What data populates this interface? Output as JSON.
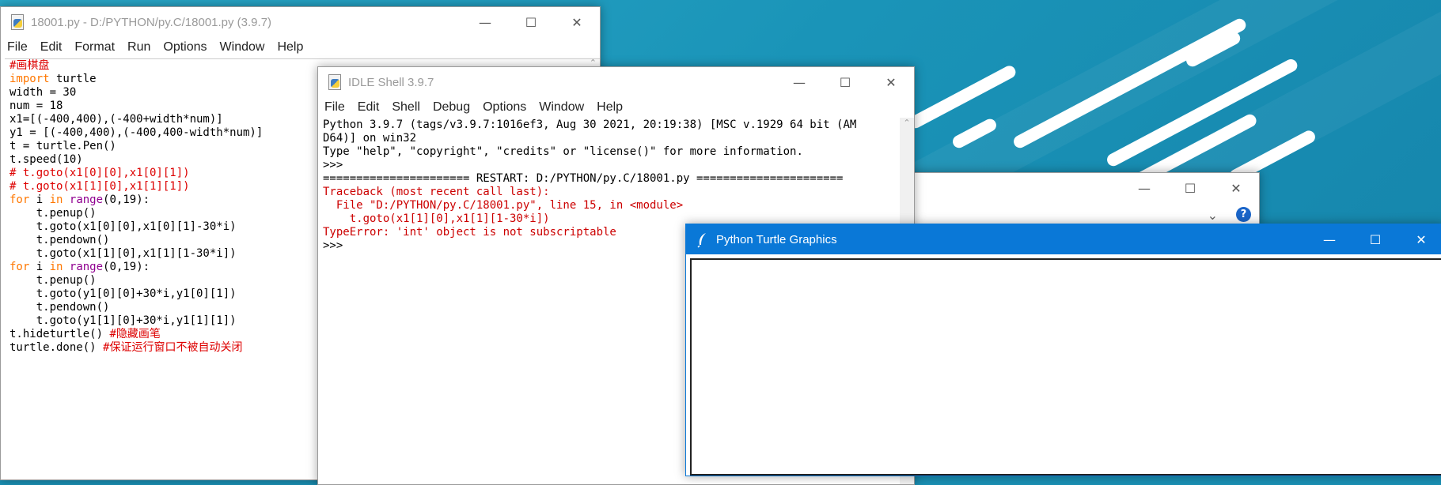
{
  "editor": {
    "title": "18001.py - D:/PYTHON/py.C/18001.py (3.9.7)",
    "menu": [
      "File",
      "Edit",
      "Format",
      "Run",
      "Options",
      "Window",
      "Help"
    ],
    "lines": [
      [
        [
          "cm",
          "#画棋盘"
        ]
      ],
      [
        [
          "kw",
          "import"
        ],
        [
          "",
          " turtle"
        ]
      ],
      [
        [
          "",
          "width = 30"
        ]
      ],
      [
        [
          "",
          "num = 18"
        ]
      ],
      [
        [
          "",
          "x1=[(-400,400),(-400+width*num)]"
        ]
      ],
      [
        [
          "",
          "y1 = [(-400,400),(-400,400-width*num)]"
        ]
      ],
      [
        [
          "",
          "t = turtle.Pen()"
        ]
      ],
      [
        [
          "",
          "t.speed(10)"
        ]
      ],
      [
        [
          "cm",
          "# t.goto(x1[0][0],x1[0][1])"
        ]
      ],
      [
        [
          "cm",
          "# t.goto(x1[1][0],x1[1][1])"
        ]
      ],
      [
        [
          "kw",
          "for"
        ],
        [
          "",
          " i "
        ],
        [
          "kw",
          "in"
        ],
        [
          "",
          " "
        ],
        [
          "bi",
          "range"
        ],
        [
          "",
          "(0,19):"
        ]
      ],
      [
        [
          "",
          "    t.penup()"
        ]
      ],
      [
        [
          "",
          "    t.goto(x1[0][0],x1[0][1]-30*i)"
        ]
      ],
      [
        [
          "",
          "    t.pendown()"
        ]
      ],
      [
        [
          "",
          "    t.goto(x1[1][0],x1[1][1-30*i])"
        ]
      ],
      [
        [
          "kw",
          "for"
        ],
        [
          "",
          " i "
        ],
        [
          "kw",
          "in"
        ],
        [
          "",
          " "
        ],
        [
          "bi",
          "range"
        ],
        [
          "",
          "(0,19):"
        ]
      ],
      [
        [
          "",
          "    t.penup()"
        ]
      ],
      [
        [
          "",
          "    t.goto(y1[0][0]+30*i,y1[0][1])"
        ]
      ],
      [
        [
          "",
          "    t.pendown()"
        ]
      ],
      [
        [
          "",
          "    t.goto(y1[1][0]+30*i,y1[1][1])"
        ]
      ],
      [
        [
          "",
          "t.hideturtle() "
        ],
        [
          "cm",
          "#隐藏画笔"
        ]
      ],
      [
        [
          "",
          "turtle.done() "
        ],
        [
          "cm",
          "#保证运行窗口不被自动关闭"
        ]
      ]
    ]
  },
  "shell": {
    "title": "IDLE Shell 3.9.7",
    "menu": [
      "File",
      "Edit",
      "Shell",
      "Debug",
      "Options",
      "Window",
      "Help"
    ],
    "lines": [
      [
        [
          "shellout",
          "Python 3.9.7 (tags/v3.9.7:1016ef3, Aug 30 2021, 20:19:38) [MSC v.1929 64 bit (AM"
        ]
      ],
      [
        [
          "shellout",
          "D64)] on win32"
        ]
      ],
      [
        [
          "shellout",
          "Type \"help\", \"copyright\", \"credits\" or \"license()\" for more information."
        ]
      ],
      [
        [
          "shellout",
          ">>> "
        ]
      ],
      [
        [
          "shellout",
          "====================== RESTART: D:/PYTHON/py.C/18001.py ======================"
        ]
      ],
      [
        [
          "err",
          "Traceback (most recent call last):"
        ]
      ],
      [
        [
          "err",
          "  File \"D:/PYTHON/py.C/18001.py\", line 15, in <module>"
        ]
      ],
      [
        [
          "err",
          "    t.goto(x1[1][0],x1[1][1-30*i])"
        ]
      ],
      [
        [
          "err",
          "TypeError: 'int' object is not subscriptable"
        ]
      ],
      [
        [
          "shellout",
          ">>> "
        ]
      ]
    ]
  },
  "turtle": {
    "title": "Python Turtle Graphics"
  },
  "caption": {
    "minimize": "—",
    "maximize": "☐",
    "close": "✕"
  },
  "behind_window": {
    "help": "?",
    "chevron": "⌄"
  },
  "colors": {
    "keyword": "#ff7700",
    "builtin": "#900090",
    "comment": "#dd0000",
    "error": "#cc0000",
    "turtle_titlebar": "#0a78d7"
  }
}
